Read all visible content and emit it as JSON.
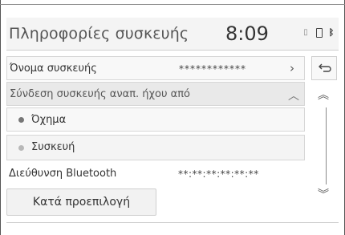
{
  "header": {
    "title": "Πληροφορίες συσκευής",
    "clock": "8:09"
  },
  "rows": {
    "device_name": {
      "label": "Όνομα συσκευής",
      "value": "************"
    },
    "connect_audio": {
      "label": "Σύνδεση συσκευής αναπ. ήχου από"
    },
    "option_vehicle": {
      "label": "Όχημα"
    },
    "option_device": {
      "label": "Συσκευή"
    },
    "bt_address": {
      "label": "Διεύθυνση Bluetooth",
      "value": "**:**:**:**:**:**"
    }
  },
  "default_button": {
    "label": "Κατά προεπιλογή"
  },
  "colors": {
    "accent": "#777777",
    "background": "#ffffff"
  }
}
